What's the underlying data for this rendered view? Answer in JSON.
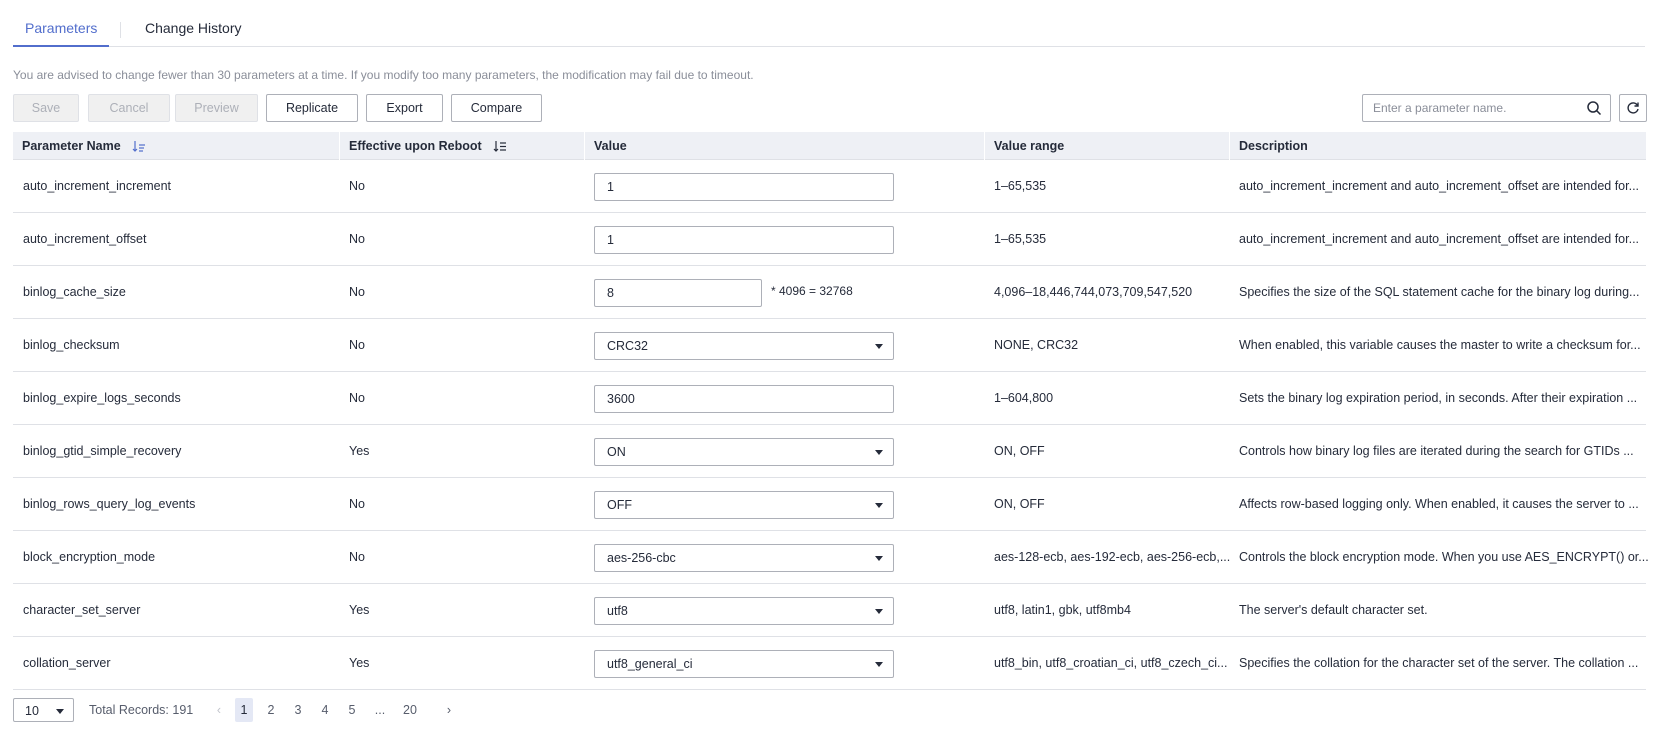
{
  "tabs": [
    {
      "label": "Parameters",
      "active": true
    },
    {
      "label": "Change History",
      "active": false
    }
  ],
  "advice": "You are advised to change fewer than 30 parameters at a time. If you modify too many parameters, the modification may fail due to timeout.",
  "toolbar": {
    "save": "Save",
    "cancel": "Cancel",
    "preview": "Preview",
    "replicate": "Replicate",
    "export": "Export",
    "compare": "Compare"
  },
  "search": {
    "placeholder": "Enter a parameter name.",
    "icon": "search-icon"
  },
  "columns": {
    "name": "Parameter Name",
    "reboot": "Effective upon Reboot",
    "value": "Value",
    "range": "Value range",
    "description": "Description"
  },
  "rows": [
    {
      "name": "auto_increment_increment",
      "reboot": "No",
      "value_type": "input",
      "value": "1",
      "range": "1–65,535",
      "description": "auto_increment_increment and auto_increment_offset are intended for..."
    },
    {
      "name": "auto_increment_offset",
      "reboot": "No",
      "value_type": "input",
      "value": "1",
      "range": "1–65,535",
      "description": "auto_increment_increment and auto_increment_offset are intended for..."
    },
    {
      "name": "binlog_cache_size",
      "reboot": "No",
      "value_type": "input-multiplier",
      "value": "8",
      "multiplier": "* 4096 = 32768",
      "range": "4,096–18,446,744,073,709,547,520",
      "description": "Specifies the size of the SQL statement cache for the binary log during..."
    },
    {
      "name": "binlog_checksum",
      "reboot": "No",
      "value_type": "select",
      "value": "CRC32",
      "range": "NONE, CRC32",
      "description": "When enabled, this variable causes the master to write a checksum for..."
    },
    {
      "name": "binlog_expire_logs_seconds",
      "reboot": "No",
      "value_type": "input",
      "value": "3600",
      "range": "1–604,800",
      "description": "Sets the binary log expiration period, in seconds. After their expiration ..."
    },
    {
      "name": "binlog_gtid_simple_recovery",
      "reboot": "Yes",
      "value_type": "select",
      "value": "ON",
      "range": "ON, OFF",
      "description": "Controls how binary log files are iterated during the search for GTIDs ..."
    },
    {
      "name": "binlog_rows_query_log_events",
      "reboot": "No",
      "value_type": "select",
      "value": "OFF",
      "range": "ON, OFF",
      "description": "Affects row-based logging only. When enabled, it causes the server to ..."
    },
    {
      "name": "block_encryption_mode",
      "reboot": "No",
      "value_type": "select",
      "value": "aes-256-cbc",
      "range": "aes-128-ecb, aes-192-ecb, aes-256-ecb,...",
      "description": "Controls the block encryption mode. When you use AES_ENCRYPT() or..."
    },
    {
      "name": "character_set_server",
      "reboot": "Yes",
      "value_type": "select",
      "value": "utf8",
      "range": "utf8, latin1, gbk, utf8mb4",
      "description": "The server's default character set."
    },
    {
      "name": "collation_server",
      "reboot": "Yes",
      "value_type": "select",
      "value": "utf8_general_ci",
      "range": "utf8_bin, utf8_croatian_ci, utf8_czech_ci...",
      "description": "Specifies the collation for the character set of the server. The collation ..."
    }
  ],
  "pagination": {
    "page_size": "10",
    "total": "Total Records: 191",
    "pages": [
      "1",
      "2",
      "3",
      "4",
      "5",
      "...",
      "20"
    ],
    "current": "1"
  },
  "colors": {
    "accent": "#526ecc",
    "header_bg": "#eef0f5",
    "border": "#dfe1e6"
  }
}
